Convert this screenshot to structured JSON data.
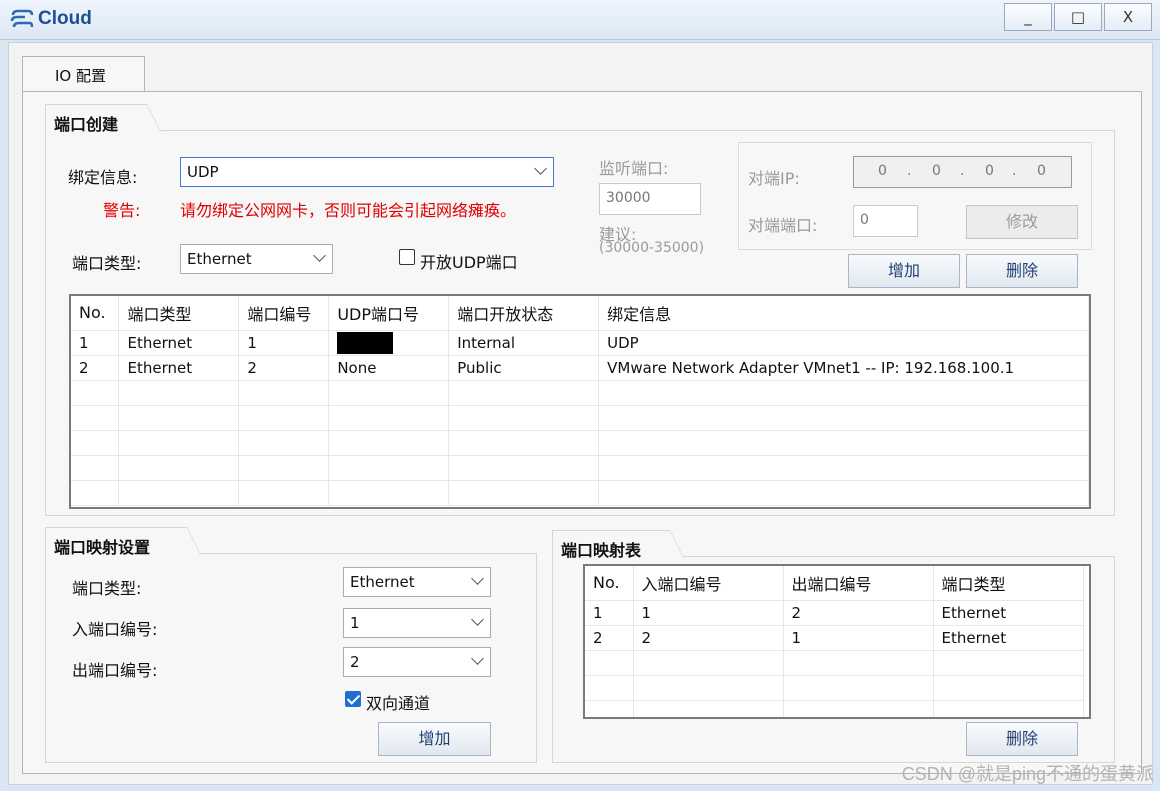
{
  "window": {
    "title": "Cloud",
    "minimize_label": "_",
    "maximize_label": "□",
    "close_label": "X"
  },
  "tabs": [
    {
      "label": "IO 配置"
    }
  ],
  "port_create": {
    "title": "端口创建",
    "bind_label": "绑定信息:",
    "bind_value": "UDP",
    "warning_label": "警告:",
    "warning_text": "请勿绑定公网网卡，否则可能会引起网络瘫痪。",
    "port_type_label": "端口类型:",
    "port_type_value": "Ethernet",
    "open_udp_label": "开放UDP端口",
    "open_udp_checked": false,
    "listen_label": "监听端口:",
    "listen_value": "30000",
    "suggest_label": "建议:",
    "suggest_range": "(30000-35000)",
    "peer_ip_label": "对端IP:",
    "peer_ip": [
      "0",
      "0",
      "0",
      "0"
    ],
    "peer_port_label": "对端端口:",
    "peer_port_value": "0",
    "modify_button": "修改",
    "add_button": "增加",
    "delete_button": "删除",
    "table": {
      "columns": [
        "No.",
        "端口类型",
        "端口编号",
        "UDP端口号",
        "端口开放状态",
        "绑定信息"
      ],
      "rows": [
        [
          "1",
          "Ethernet",
          "1",
          "",
          "Internal",
          "UDP"
        ],
        [
          "2",
          "Ethernet",
          "2",
          "None",
          "Public",
          "VMware Network Adapter VMnet1 -- IP: 192.168.100.1"
        ]
      ]
    }
  },
  "mapping_settings": {
    "title": "端口映射设置",
    "port_type_label": "端口类型:",
    "port_type_value": "Ethernet",
    "in_port_label": "入端口编号:",
    "in_port_value": "1",
    "out_port_label": "出端口编号:",
    "out_port_value": "2",
    "bidirectional_label": "双向通道",
    "bidirectional_checked": true,
    "add_button": "增加"
  },
  "mapping_table": {
    "title": "端口映射表",
    "columns": [
      "No.",
      "入端口编号",
      "出端口编号",
      "端口类型"
    ],
    "rows": [
      [
        "1",
        "1",
        "2",
        "Ethernet"
      ],
      [
        "2",
        "2",
        "1",
        "Ethernet"
      ]
    ],
    "delete_button": "删除"
  },
  "watermark": "CSDN @就是ping不通的蛋黄派",
  "colors": {
    "title": "#1e4f95",
    "warning": "#e00000",
    "checkbox_on": "#1f6fd0"
  }
}
